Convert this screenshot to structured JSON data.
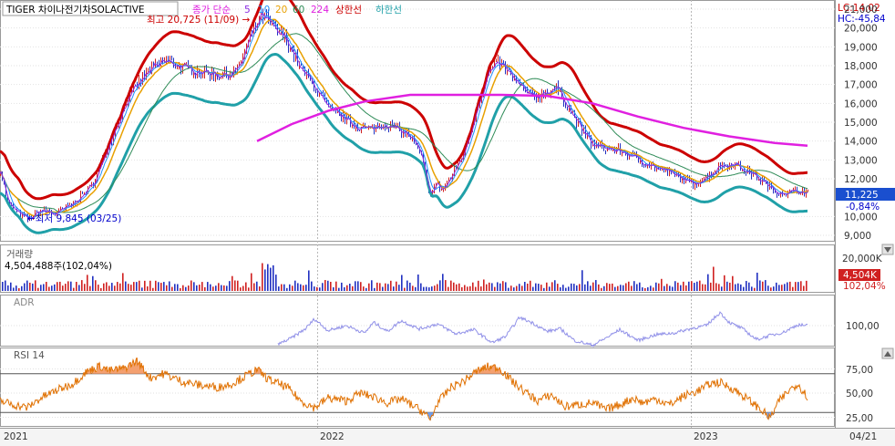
{
  "chart_data": {
    "type": "line",
    "title": "TIGER 차이나전기차SOLACTIVE",
    "price_panel": {
      "legend": {
        "prefix": "종가 단순",
        "periods": [
          "5",
          "10",
          "20",
          "60",
          "224"
        ],
        "upper": "상한선",
        "lower": "하한선"
      },
      "lc_label": "LC:14,02",
      "hc_label": "HC:-45,84",
      "current_price": "11,225",
      "change_pct": "-0,84%",
      "max_annotation": "최고 20,725 (11/09) →",
      "min_annotation": "←최저 9,845 (03/25)",
      "yticks": [
        "21,000",
        "20,000",
        "19,000",
        "18,000",
        "17,000",
        "16,000",
        "15,000",
        "14,000",
        "13,000",
        "12,000",
        "10,000",
        "9,000"
      ],
      "ylim": [
        8600,
        21300
      ],
      "close_keypoints": [
        [
          0,
          12500
        ],
        [
          8,
          10700
        ],
        [
          22,
          10100
        ],
        [
          30,
          9845
        ],
        [
          45,
          10350
        ],
        [
          60,
          10150
        ],
        [
          80,
          10700
        ],
        [
          100,
          11600
        ],
        [
          120,
          13900
        ],
        [
          140,
          16300
        ],
        [
          160,
          17600
        ],
        [
          180,
          18300
        ],
        [
          200,
          17900
        ],
        [
          220,
          17700
        ],
        [
          240,
          17500
        ],
        [
          260,
          17700
        ],
        [
          275,
          19600
        ],
        [
          287,
          20725
        ],
        [
          300,
          20000
        ],
        [
          315,
          19300
        ],
        [
          330,
          17800
        ],
        [
          345,
          16900
        ],
        [
          360,
          15700
        ],
        [
          375,
          15300
        ],
        [
          390,
          14800
        ],
        [
          405,
          14600
        ],
        [
          420,
          14900
        ],
        [
          435,
          14700
        ],
        [
          450,
          14200
        ],
        [
          462,
          13200
        ],
        [
          470,
          11200
        ],
        [
          478,
          11700
        ],
        [
          485,
          11400
        ],
        [
          497,
          12300
        ],
        [
          510,
          13600
        ],
        [
          522,
          15700
        ],
        [
          535,
          17600
        ],
        [
          547,
          18200
        ],
        [
          558,
          17600
        ],
        [
          570,
          16900
        ],
        [
          585,
          16300
        ],
        [
          598,
          16600
        ],
        [
          610,
          16800
        ],
        [
          622,
          15900
        ],
        [
          635,
          14800
        ],
        [
          650,
          13800
        ],
        [
          665,
          13600
        ],
        [
          680,
          13500
        ],
        [
          693,
          13200
        ],
        [
          705,
          12900
        ],
        [
          718,
          12600
        ],
        [
          730,
          12400
        ],
        [
          745,
          12100
        ],
        [
          760,
          11700
        ],
        [
          775,
          12100
        ],
        [
          790,
          12700
        ],
        [
          805,
          12800
        ],
        [
          820,
          12400
        ],
        [
          835,
          11900
        ],
        [
          850,
          11300
        ],
        [
          865,
          11250
        ],
        [
          878,
          11400
        ],
        [
          886,
          11225
        ]
      ],
      "ma224_keypoints": [
        [
          282,
          14000
        ],
        [
          320,
          14900
        ],
        [
          360,
          15600
        ],
        [
          400,
          16100
        ],
        [
          450,
          16450
        ],
        [
          500,
          16450
        ],
        [
          550,
          16450
        ],
        [
          600,
          16400
        ],
        [
          650,
          16000
        ],
        [
          700,
          15300
        ],
        [
          750,
          14700
        ],
        [
          800,
          14250
        ],
        [
          850,
          13900
        ],
        [
          886,
          13750
        ]
      ]
    },
    "volume_panel": {
      "title": "거래량",
      "value_text": "4,504,488주(102,04%)",
      "ytick": "20,000K",
      "current_badge": "4,504K",
      "current_pct": "102,04%"
    },
    "adr_panel": {
      "title": "ADR",
      "ytick": "100,00",
      "keypoints": [
        [
          305,
          77
        ],
        [
          320,
          85
        ],
        [
          335,
          96
        ],
        [
          345,
          108
        ],
        [
          360,
          94
        ],
        [
          380,
          100
        ],
        [
          400,
          91
        ],
        [
          410,
          104
        ],
        [
          425,
          93
        ],
        [
          440,
          106
        ],
        [
          460,
          96
        ],
        [
          480,
          102
        ],
        [
          500,
          90
        ],
        [
          520,
          95
        ],
        [
          540,
          79
        ],
        [
          555,
          87
        ],
        [
          570,
          110
        ],
        [
          585,
          103
        ],
        [
          600,
          93
        ],
        [
          615,
          96
        ],
        [
          630,
          82
        ],
        [
          650,
          76
        ],
        [
          665,
          85
        ],
        [
          680,
          95
        ],
        [
          700,
          82
        ],
        [
          720,
          89
        ],
        [
          740,
          91
        ],
        [
          760,
          97
        ],
        [
          775,
          100
        ],
        [
          790,
          116
        ],
        [
          800,
          104
        ],
        [
          815,
          96
        ],
        [
          830,
          83
        ],
        [
          845,
          88
        ],
        [
          860,
          92
        ],
        [
          875,
          101
        ],
        [
          886,
          100
        ]
      ]
    },
    "rsi_panel": {
      "title": "RSI 14",
      "yticks": [
        "75,00",
        "50,00",
        "25,00"
      ],
      "overbought": 70,
      "oversold": 30,
      "keypoints": [
        [
          0,
          42
        ],
        [
          15,
          38
        ],
        [
          30,
          35
        ],
        [
          45,
          45
        ],
        [
          60,
          52
        ],
        [
          80,
          60
        ],
        [
          95,
          72
        ],
        [
          110,
          78
        ],
        [
          120,
          73
        ],
        [
          135,
          75
        ],
        [
          150,
          83
        ],
        [
          165,
          66
        ],
        [
          180,
          70
        ],
        [
          200,
          62
        ],
        [
          220,
          58
        ],
        [
          240,
          56
        ],
        [
          255,
          60
        ],
        [
          270,
          68
        ],
        [
          282,
          74
        ],
        [
          295,
          64
        ],
        [
          315,
          56
        ],
        [
          330,
          42
        ],
        [
          345,
          35
        ],
        [
          360,
          45
        ],
        [
          380,
          42
        ],
        [
          395,
          50
        ],
        [
          410,
          46
        ],
        [
          425,
          40
        ],
        [
          440,
          44
        ],
        [
          455,
          36
        ],
        [
          465,
          30
        ],
        [
          472,
          22
        ],
        [
          480,
          40
        ],
        [
          495,
          56
        ],
        [
          510,
          63
        ],
        [
          522,
          72
        ],
        [
          535,
          77
        ],
        [
          548,
          76
        ],
        [
          560,
          64
        ],
        [
          575,
          52
        ],
        [
          590,
          42
        ],
        [
          605,
          48
        ],
        [
          620,
          36
        ],
        [
          635,
          38
        ],
        [
          650,
          40
        ],
        [
          665,
          33
        ],
        [
          680,
          38
        ],
        [
          695,
          45
        ],
        [
          705,
          40
        ],
        [
          720,
          44
        ],
        [
          735,
          38
        ],
        [
          750,
          47
        ],
        [
          765,
          52
        ],
        [
          780,
          60
        ],
        [
          790,
          61
        ],
        [
          805,
          54
        ],
        [
          820,
          44
        ],
        [
          835,
          33
        ],
        [
          845,
          24
        ],
        [
          855,
          42
        ],
        [
          865,
          52
        ],
        [
          875,
          60
        ],
        [
          886,
          46
        ]
      ]
    },
    "x_axis": {
      "labels": [
        "2021",
        "2022",
        "2023"
      ],
      "date_label": "04/21"
    },
    "colors": {
      "ma5": "#8a2be2",
      "ma10": "#1e90ff",
      "ma20": "#e8a000",
      "ma60": "#2e8b57",
      "ma224": "#e020e0",
      "upper": "#cc0000",
      "lower": "#20a0a8",
      "rsi": "#e07000",
      "adr": "#9090e8",
      "up_bar": "#d02020",
      "down_bar": "#2030c0"
    }
  }
}
